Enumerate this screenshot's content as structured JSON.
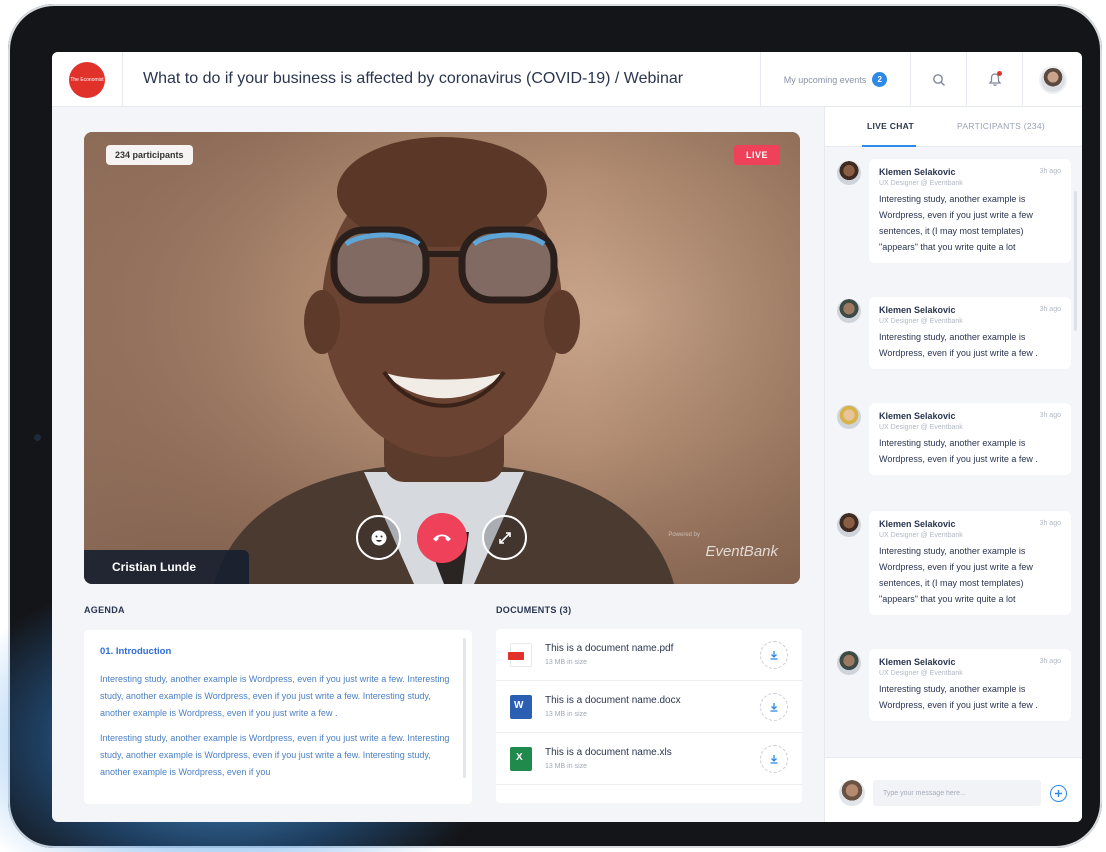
{
  "header": {
    "logo_text": "The Economist",
    "title": "What to do if your business is affected by coronavirus (COVID-19) / Webinar",
    "upcoming_label": "My upcoming events",
    "upcoming_count": "2"
  },
  "video": {
    "participants_chip": "234 participants",
    "live_label": "LIVE",
    "speaker_name": "Cristian Lunde",
    "watermark": "EventBank",
    "watermark_small": "Powered by"
  },
  "agenda": {
    "label": "AGENDA",
    "item_title": "01. Introduction",
    "paragraphs": [
      "Interesting study, another example is Wordpress, even if you just write a few. Interesting study, another example is Wordpress, even if you just write a few. Interesting study, another example is Wordpress, even if you just write a few .",
      "Interesting study, another example is Wordpress, even if you just write a few. Interesting study, another example is Wordpress, even if you just write a few. Interesting study, another example is Wordpress, even if you"
    ]
  },
  "documents": {
    "label": "DOCUMENTS (3)",
    "items": [
      {
        "name": "This is a document name.pdf",
        "size": "13 MB in size",
        "type": "pdf",
        "color": "#e0312a"
      },
      {
        "name": "This is a document name.docx",
        "size": "13 MB in size",
        "type": "docx",
        "color": "#2b5fb3"
      },
      {
        "name": "This is a document name.xls",
        "size": "13 MB in size",
        "type": "xls",
        "color": "#1f8a4c"
      }
    ]
  },
  "chat": {
    "tab_live": "LIVE CHAT",
    "tab_participants": "PARTICIPANTS (234)",
    "messages": [
      {
        "name": "Klemen Selakovic",
        "role": "UX Designer @ Eventbank",
        "time": "3h ago",
        "text": "Interesting study, another example is Wordpress, even if you just write a few sentences, it (I may most templates) \"appears\" that you write quite a lot"
      },
      {
        "name": "Klemen Selakovic",
        "role": "UX Designer @ Eventbank",
        "time": "3h ago",
        "text": "Interesting study, another example is Wordpress, even if you just write a few ."
      },
      {
        "name": "Klemen Selakovic",
        "role": "UX Designer @ Eventbank",
        "time": "3h ago",
        "text": "Interesting study, another example is Wordpress, even if you just write a few ."
      },
      {
        "name": "Klemen Selakovic",
        "role": "UX Designer @ Eventbank",
        "time": "3h ago",
        "text": "Interesting study, another example is Wordpress, even if you just write a few sentences, it (I may most templates) \"appears\" that you write quite a lot"
      },
      {
        "name": "Klemen Selakovic",
        "role": "UX Designer @ Eventbank",
        "time": "3h ago",
        "text": "Interesting study, another example is Wordpress, even if you just write a few ."
      }
    ],
    "input_placeholder": "Type your message here..."
  },
  "colors": {
    "accent": "#2e8ae6",
    "live": "#f0415a",
    "brand": "#e0312a"
  }
}
